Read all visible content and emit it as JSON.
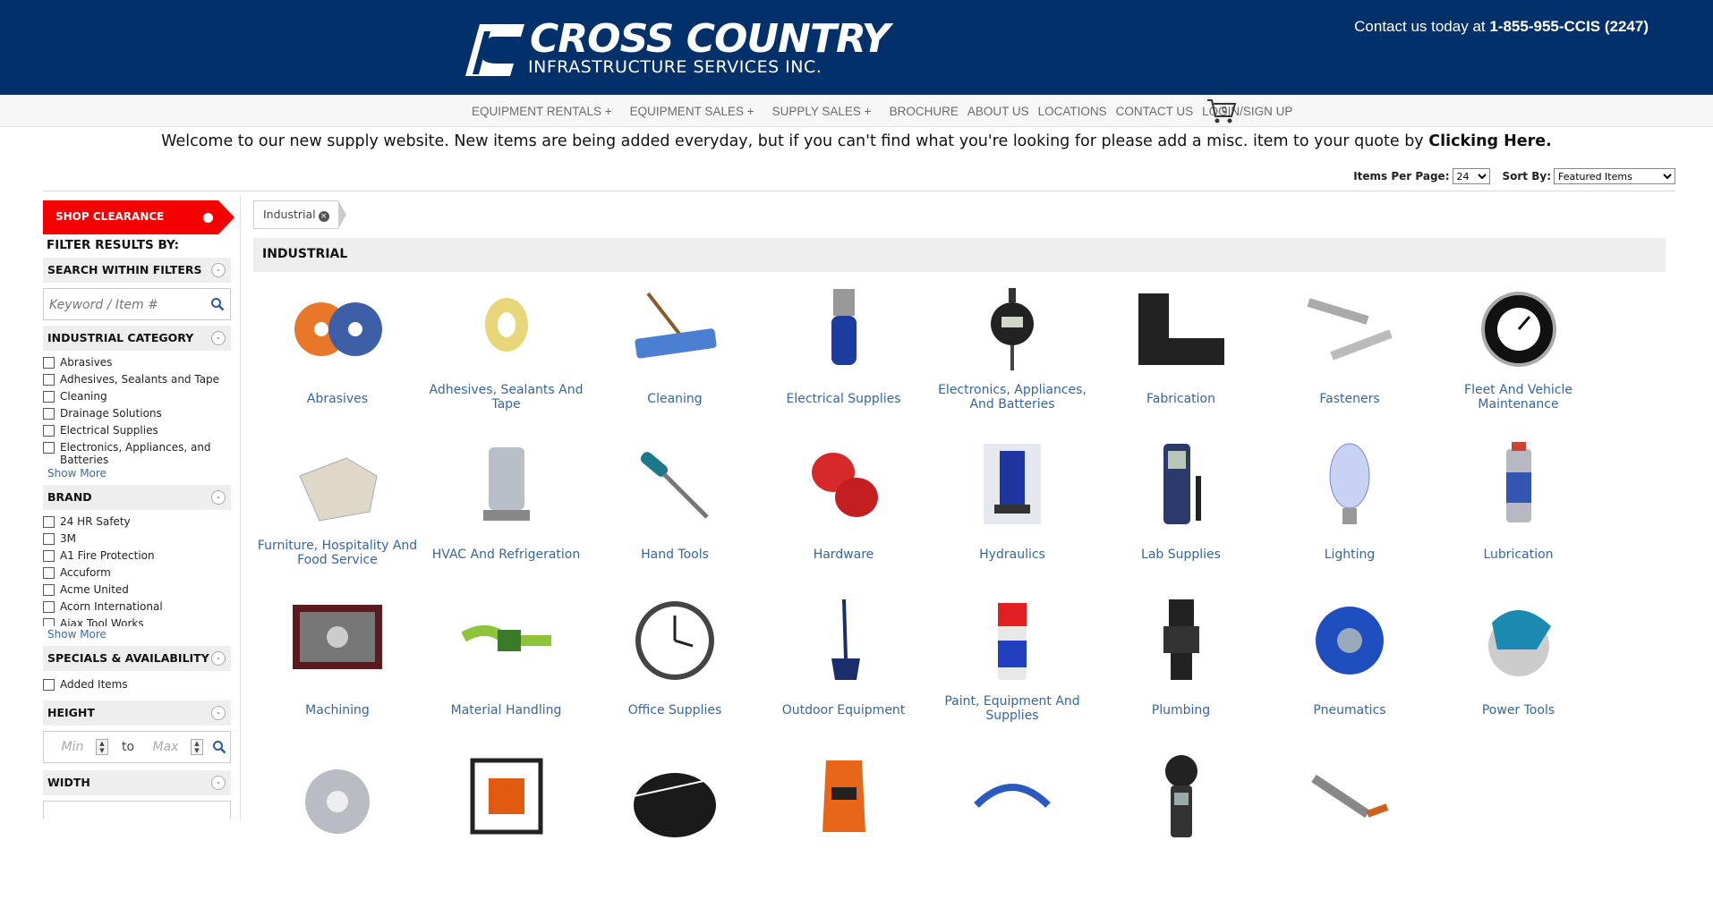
{
  "header": {
    "logo_main": "CROSS COUNTRY",
    "logo_sub": "INFRASTRUCTURE SERVICES INC.",
    "contact_prefix": "Contact us today at ",
    "contact_phone": "1-855-955-CCIS (2247)"
  },
  "nav": {
    "items": [
      "EQUIPMENT RENTALS +",
      "EQUIPMENT SALES +",
      "SUPPLY SALES +",
      "BROCHURE",
      "ABOUT US",
      "LOCATIONS",
      "CONTACT US",
      "LOGIN/SIGN UP"
    ],
    "cart_count": "0"
  },
  "welcome": {
    "text": "Welcome to our new supply website. New items are being added everyday, but if you can't find what you're looking for please add a misc. item to your quote by ",
    "link": "Clicking Here."
  },
  "toolbar": {
    "per_page_label": "Items Per Page:",
    "per_page_value": "24",
    "sort_label": "Sort By:",
    "sort_value": "Featured Items"
  },
  "sidebar": {
    "clearance": "SHOP CLEARANCE",
    "filter_title": "FILTER RESULTS BY:",
    "search_section": "SEARCH WITHIN FILTERS",
    "search_placeholder": "Keyword / Item #",
    "category_section": "INDUSTRIAL CATEGORY",
    "categories": [
      "Abrasives",
      "Adhesives, Sealants and Tape",
      "Cleaning",
      "Drainage Solutions",
      "Electrical Supplies",
      "Electronics, Appliances, and Batteries"
    ],
    "show_more": "Show More",
    "brand_section": "BRAND",
    "brands": [
      "24 HR Safety",
      "3M",
      "A1 Fire Protection",
      "Accuform",
      "Acme United",
      "Acorn International",
      "Ajax Tool Works"
    ],
    "specials_section": "SPECIALS & AVAILABILITY",
    "specials": [
      "Added Items"
    ],
    "height_section": "HEIGHT",
    "min_placeholder": "Min",
    "max_placeholder": "Max",
    "to_label": "to",
    "width_section": "WIDTH",
    "toggle": "-"
  },
  "breadcrumb": {
    "tag": "Industrial",
    "remove": "×"
  },
  "category_title": "INDUSTRIAL",
  "tiles": [
    {
      "label": "Abrasives",
      "icon": "abrasive-disc-icon"
    },
    {
      "label": "Adhesives, Sealants And Tape",
      "icon": "tape-roll-icon"
    },
    {
      "label": "Cleaning",
      "icon": "mop-icon"
    },
    {
      "label": "Electrical Supplies",
      "icon": "connector-icon"
    },
    {
      "label": "Electronics, Appliances, And Batteries",
      "icon": "gauge-icon"
    },
    {
      "label": "Fabrication",
      "icon": "fabrication-block-icon"
    },
    {
      "label": "Fasteners",
      "icon": "screw-icon"
    },
    {
      "label": "Fleet And Vehicle Maintenance",
      "icon": "vehicle-gauge-icon"
    },
    {
      "label": "Furniture, Hospitality And Food Service",
      "icon": "tarp-icon"
    },
    {
      "label": "HVAC And Refrigeration",
      "icon": "heater-icon"
    },
    {
      "label": "Hand Tools",
      "icon": "screwdriver-icon"
    },
    {
      "label": "Hardware",
      "icon": "magnet-icon"
    },
    {
      "label": "Hydraulics",
      "icon": "hydraulic-jack-icon"
    },
    {
      "label": "Lab Supplies",
      "icon": "meter-icon"
    },
    {
      "label": "Lighting",
      "icon": "bulb-icon"
    },
    {
      "label": "Lubrication",
      "icon": "spray-can-icon"
    },
    {
      "label": "Machining",
      "icon": "tap-die-set-icon"
    },
    {
      "label": "Material Handling",
      "icon": "ratchet-strap-icon"
    },
    {
      "label": "Office Supplies",
      "icon": "clock-icon"
    },
    {
      "label": "Outdoor Equipment",
      "icon": "ice-scraper-icon"
    },
    {
      "label": "Paint, Equipment And Supplies",
      "icon": "paint-can-icon"
    },
    {
      "label": "Plumbing",
      "icon": "pipe-coupling-icon"
    },
    {
      "label": "Pneumatics",
      "icon": "hose-reel-icon"
    },
    {
      "label": "Power Tools",
      "icon": "circular-saw-icon"
    },
    {
      "label": "",
      "icon": "pulley-icon"
    },
    {
      "label": "",
      "icon": "pump-icon"
    },
    {
      "label": "",
      "icon": "rubber-roll-icon"
    },
    {
      "label": "",
      "icon": "safety-glove-icon"
    },
    {
      "label": "",
      "icon": "cable-icon"
    },
    {
      "label": "",
      "icon": "anemometer-icon"
    },
    {
      "label": "",
      "icon": "welding-torch-icon"
    }
  ]
}
